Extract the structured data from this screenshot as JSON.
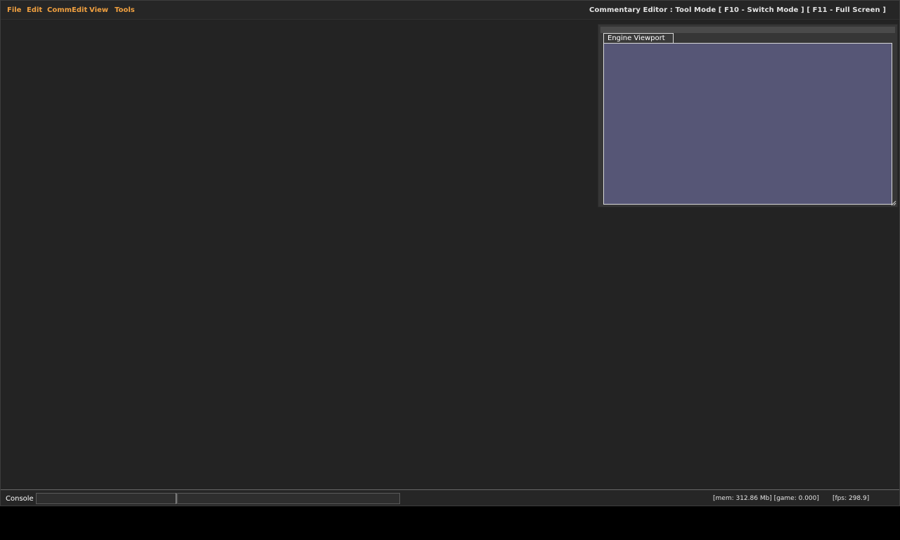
{
  "menu": {
    "items": [
      "File",
      "Edit",
      "CommEdit",
      "View",
      "Tools"
    ]
  },
  "header": {
    "mode_title": "Commentary Editor : Tool Mode [ F10 - Switch Mode ] [ F11 - Full Screen ]"
  },
  "viewport_panel": {
    "tab_label": "Engine Viewport"
  },
  "statusbar": {
    "console_label": "Console",
    "console_value": "",
    "mem_stats": "[mem: 312.86 Mb] [game: 0.000]",
    "fps_stats": "[fps:  298.9]"
  },
  "colors": {
    "menu_accent": "#f0a040",
    "viewport_background": "#565676"
  }
}
